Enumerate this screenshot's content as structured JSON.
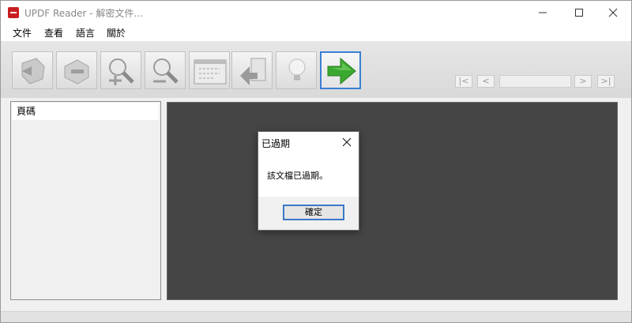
{
  "window": {
    "title": "UPDF Reader - 解密文件...",
    "icon": "updf-app-icon"
  },
  "menu": {
    "items": [
      "文件",
      "查看",
      "語言",
      "關於"
    ]
  },
  "toolbar": {
    "buttons": [
      {
        "icon": "page-prev-shape-icon"
      },
      {
        "icon": "page-next-shape-icon"
      },
      {
        "icon": "zoom-in-icon"
      },
      {
        "icon": "zoom-out-icon"
      },
      {
        "icon": "text-view-icon"
      },
      {
        "icon": "rotate-icon"
      },
      {
        "icon": "lightbulb-icon"
      },
      {
        "icon": "green-arrow-icon",
        "active": true
      }
    ],
    "nav": {
      "first_label": "|<",
      "prev_label": "<",
      "page_value": "",
      "next_label": ">",
      "last_label": ">|"
    }
  },
  "sidebar": {
    "header": "頁碼"
  },
  "dialog": {
    "title": "已過期",
    "message": "該文檔已過期。",
    "ok_label": "確定"
  },
  "colors": {
    "accent": "#3c7fd4",
    "main_bg": "#454545",
    "arrow_green": "#3aa82e",
    "icon_red": "#c81d1d"
  }
}
